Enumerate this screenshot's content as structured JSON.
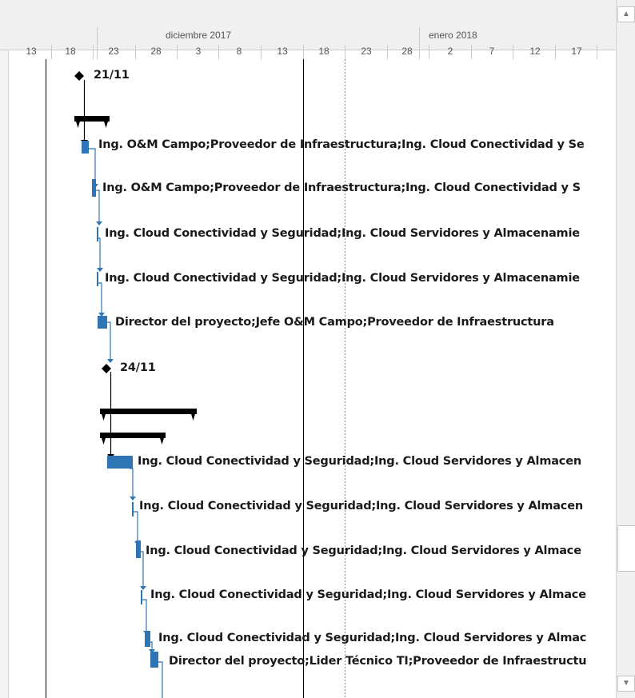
{
  "timeline": {
    "months": [
      "diciembre 2017",
      "enero 2018"
    ],
    "days": [
      "13",
      "18",
      "23",
      "28",
      "3",
      "8",
      "13",
      "18",
      "23",
      "28",
      "2",
      "7",
      "12",
      "17"
    ]
  },
  "milestones": [
    "21/11",
    "24/11"
  ],
  "tasks": [
    "Ing. O&M Campo;Proveedor de Infraestructura;Ing. Cloud Conectividad y Se",
    "Ing. O&M Campo;Proveedor de Infraestructura;Ing. Cloud Conectividad y S",
    "Ing. Cloud Conectividad y Seguridad;Ing. Cloud Servidores y Almacenamie",
    "Ing. Cloud Conectividad y Seguridad;Ing. Cloud Servidores y Almacenamie",
    "Director del proyecto;Jefe O&M Campo;Proveedor de Infraestructura",
    "Ing. Cloud Conectividad y Seguridad;Ing. Cloud Servidores y Almacen",
    "Ing. Cloud Conectividad y Seguridad;Ing. Cloud Servidores y Almacen",
    "Ing. Cloud Conectividad y Seguridad;Ing. Cloud Servidores y Almace",
    "Ing. Cloud Conectividad y Seguridad;Ing. Cloud Servidores y Almace",
    "Ing. Cloud Conectividad y Seguridad;Ing. Cloud Servidores y Almac",
    "Director del proyecto;Lider Técnico TI;Proveedor de Infraestructu"
  ],
  "colors": {
    "task_bar": "#2e75b6",
    "summary_bar": "#000000",
    "link_line": "#2e75b6",
    "milestone": "#000000"
  },
  "scrollbar": {
    "up_icon": "arrow-up-icon",
    "down_icon": "arrow-down-icon"
  }
}
